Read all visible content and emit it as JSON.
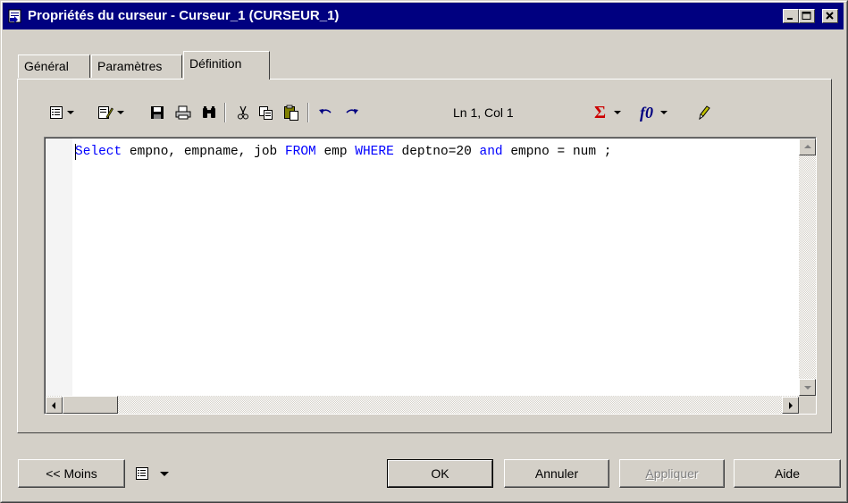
{
  "window": {
    "title": "Propriétés du curseur - Curseur_1 (CURSEUR_1)"
  },
  "tabs": [
    {
      "label": "Général",
      "active": false
    },
    {
      "label": "Paramètres",
      "active": false
    },
    {
      "label": "Définition",
      "active": true
    }
  ],
  "toolbar": {
    "icons": [
      "properties-list-icon",
      "edit-icon",
      "save-icon",
      "print-icon",
      "find-icon",
      "cut-icon",
      "copy-icon",
      "paste-icon",
      "undo-icon",
      "redo-icon",
      "sum-icon",
      "function-icon",
      "pencil-icon"
    ],
    "position_label": "Ln 1, Col 1",
    "sum_label": "Σ",
    "function_label": "f0"
  },
  "editor": {
    "tokens": [
      {
        "text": "Select",
        "kw": true
      },
      {
        "text": " empno, empname, job ",
        "kw": false
      },
      {
        "text": "FROM",
        "kw": true
      },
      {
        "text": " emp ",
        "kw": false
      },
      {
        "text": "WHERE",
        "kw": true
      },
      {
        "text": " deptno=20 ",
        "kw": false
      },
      {
        "text": "and",
        "kw": true
      },
      {
        "text": " empno = num ;",
        "kw": false
      }
    ]
  },
  "buttons": {
    "less": "<< Moins",
    "ok": "OK",
    "cancel": "Annuler",
    "apply_prefix": "A",
    "apply_rest": "ppliquer",
    "help": "Aide"
  },
  "colors": {
    "titlebar": "#000080",
    "keyword": "#0000ff",
    "face": "#d4d0c8",
    "sum_icon": "#cc0000",
    "function_icon": "#000080"
  }
}
